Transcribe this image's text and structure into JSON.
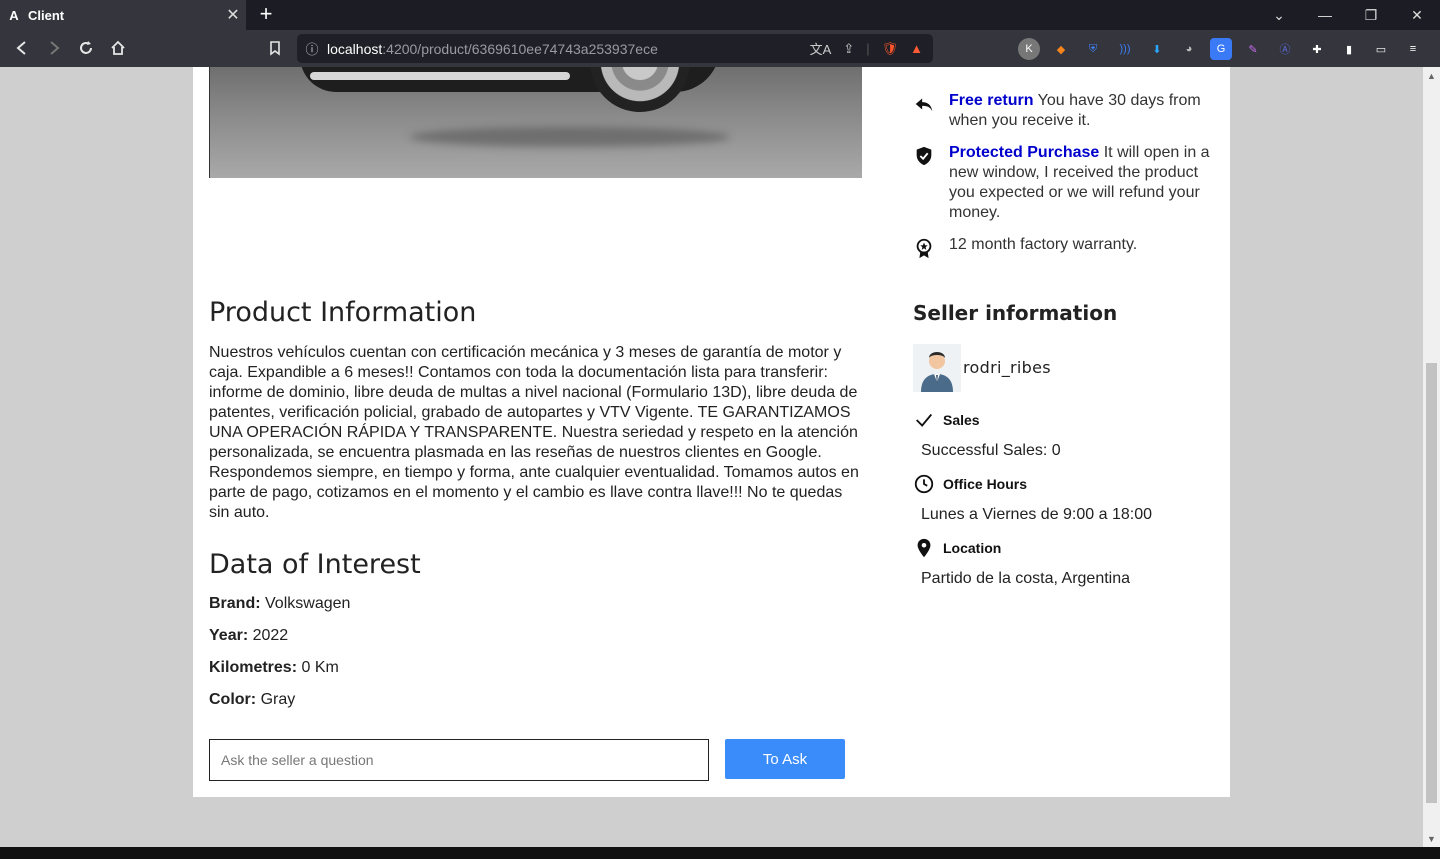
{
  "browser": {
    "tab_title": "Client",
    "tab_favicon": "A",
    "url_host": "localhost",
    "url_path": ":4200/product/6369610ee74743a253937ece"
  },
  "product": {
    "info_title": "Product Information",
    "description": "Nuestros vehículos cuentan con certificación mecánica y 3 meses de garantía de motor y caja. Expandible a 6 meses!! Contamos con toda la documentación lista para transferir: informe de dominio, libre deuda de multas a nivel nacional (Formulario 13D), libre deuda de patentes, verificación policial, grabado de autopartes y VTV Vigente. TE GARANTIZAMOS UNA OPERACIÓN RÁPIDA Y TRANSPARENTE. Nuestra seriedad y respeto en la atención personalizada, se encuentra plasmada en las reseñas de nuestros clientes en Google. Respondemos siempre, en tiempo y forma, ante cualquier eventualidad. Tomamos autos en parte de pago, cotizamos en el momento y el cambio es llave contra llave!!! No te quedas sin auto.",
    "interest_title": "Data of Interest",
    "specs": [
      {
        "label": "Brand:",
        "value": "Volkswagen"
      },
      {
        "label": "Year:",
        "value": "2022"
      },
      {
        "label": "Kilometres:",
        "value": "0 Km"
      },
      {
        "label": "Color:",
        "value": "Gray"
      }
    ],
    "ask_placeholder": "Ask the seller a question",
    "ask_button": "To Ask"
  },
  "benefits": [
    {
      "icon": "return-arrow-icon",
      "title": "Free return",
      "text": "You have 30 days from when you receive it."
    },
    {
      "icon": "shield-check-icon",
      "title": "Protected Purchase",
      "text": "It will open in a new window, I received the product you expected or we will refund your money."
    },
    {
      "icon": "award-badge-icon",
      "title": "",
      "text": "12 month factory warranty."
    }
  ],
  "seller": {
    "title": "Seller information",
    "name": "rodri_ribes",
    "sales_label": "Sales",
    "sales_value": "Successful Sales: 0",
    "hours_label": "Office Hours",
    "hours_value": "Lunes a Viernes de 9:00 a 18:00",
    "location_label": "Location",
    "location_value": "Partido de la costa, Argentina"
  },
  "colors": {
    "accent_link": "#0000cc",
    "button_blue": "#3b8cfb"
  }
}
